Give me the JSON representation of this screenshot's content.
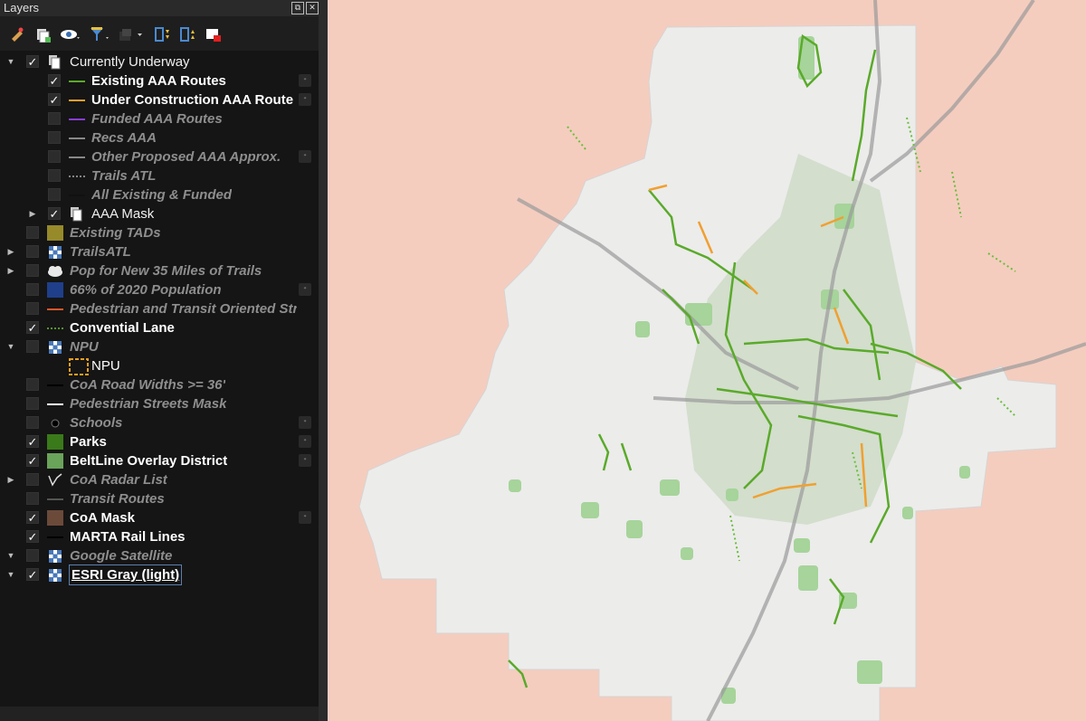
{
  "panel": {
    "title": "Layers"
  },
  "toolbar": {
    "buttons": [
      "style-manager-icon",
      "add-group-icon",
      "visibility-icon",
      "filter-legend-icon",
      "filter-expression-icon",
      "expand-all-icon",
      "collapse-all-icon",
      "remove-layer-icon"
    ]
  },
  "layers": [
    {
      "label": "Currently Underway",
      "checked": true,
      "style": "grp",
      "arrow": "down",
      "symbol": "group-icon"
    },
    {
      "label": "Existing AAA Routes",
      "checked": true,
      "style": "on",
      "symbol": "line",
      "color": "#5aaa2a"
    },
    {
      "label": "Under Construction AAA Route",
      "checked": true,
      "style": "on",
      "symbol": "line",
      "color": "#f0a030"
    },
    {
      "label": "Funded AAA Routes",
      "checked": false,
      "style": "off",
      "symbol": "line",
      "color": "#8a3bd8"
    },
    {
      "label": "Recs AAA",
      "checked": false,
      "style": "off",
      "symbol": "line",
      "color": "#888888"
    },
    {
      "label": "Other Proposed AAA Approx.",
      "checked": false,
      "style": "off",
      "symbol": "line",
      "color": "#888888"
    },
    {
      "label": "Trails ATL",
      "checked": false,
      "style": "off",
      "symbol": "dotted",
      "color": "#aaaaaa"
    },
    {
      "label": "All Existing & Funded",
      "checked": false,
      "style": "off",
      "symbol": "line",
      "color": "#111111"
    },
    {
      "label": "AAA Mask",
      "checked": true,
      "style": "grp",
      "arrow": "right",
      "symbol": "group-icon"
    },
    {
      "label": "Existing TADs",
      "checked": false,
      "style": "off",
      "symbol": "fill",
      "color": "#968a2a"
    },
    {
      "label": "TrailsATL",
      "checked": false,
      "style": "off",
      "arrow": "right",
      "symbol": "raster-icon"
    },
    {
      "label": "Pop for New 35 Miles of Trails",
      "checked": false,
      "style": "off",
      "arrow": "right",
      "symbol": "cloud-icon"
    },
    {
      "label": "66% of 2020 Population",
      "checked": false,
      "style": "off",
      "symbol": "fill",
      "color": "#1f3f8a"
    },
    {
      "label": "Pedestrian and Transit Oriented Stre",
      "checked": false,
      "style": "off",
      "symbol": "line",
      "color": "#e0552a"
    },
    {
      "label": "Convential Lane",
      "checked": true,
      "style": "on",
      "symbol": "dotted",
      "color": "#6abf3a"
    },
    {
      "label": "NPU",
      "checked": false,
      "style": "off",
      "arrow": "down",
      "symbol": "raster-icon"
    },
    {
      "label": "NPU",
      "checked": null,
      "style": "plain",
      "symbol": "dashed-box",
      "color": "#e8a020"
    },
    {
      "label": "CoA Road Widths >= 36'",
      "checked": false,
      "style": "off",
      "symbol": "line",
      "color": "#000000"
    },
    {
      "label": "Pedestrian Streets Mask",
      "checked": false,
      "style": "off",
      "symbol": "line",
      "color": "#ffffff"
    },
    {
      "label": "Schools",
      "checked": false,
      "style": "off",
      "symbol": "dot",
      "color": "#000000"
    },
    {
      "label": "Parks",
      "checked": true,
      "style": "on",
      "symbol": "fill",
      "color": "#3a7a1a"
    },
    {
      "label": "BeltLine Overlay District",
      "checked": true,
      "style": "on",
      "symbol": "fill",
      "color": "#6aa35a"
    },
    {
      "label": "CoA Radar List",
      "checked": false,
      "style": "off",
      "arrow": "right",
      "symbol": "radar-icon"
    },
    {
      "label": "Transit Routes",
      "checked": false,
      "style": "off",
      "symbol": "line",
      "color": "#555555"
    },
    {
      "label": "CoA Mask",
      "checked": true,
      "style": "on",
      "symbol": "fill",
      "color": "#6b4a3a"
    },
    {
      "label": "MARTA Rail Lines",
      "checked": true,
      "style": "on",
      "symbol": "line",
      "color": "#000000"
    },
    {
      "label": "Google Satellite",
      "checked": false,
      "style": "off",
      "arrow": "down",
      "symbol": "raster-icon"
    },
    {
      "label": "ESRI Gray (light)",
      "checked": true,
      "style": "on",
      "arrow": "down",
      "symbol": "raster-icon",
      "selected": true
    }
  ],
  "map": {
    "colors": {
      "outside_mask": "#f4cdbf",
      "city": "#ececeb",
      "beltline": "#cfdcc8",
      "parks": "#a6d49a",
      "existing_routes": "#5aaa2a",
      "construction_routes": "#f0a030",
      "conventional_lanes": "#6abf3a",
      "highways": "#9a9a9a"
    }
  }
}
